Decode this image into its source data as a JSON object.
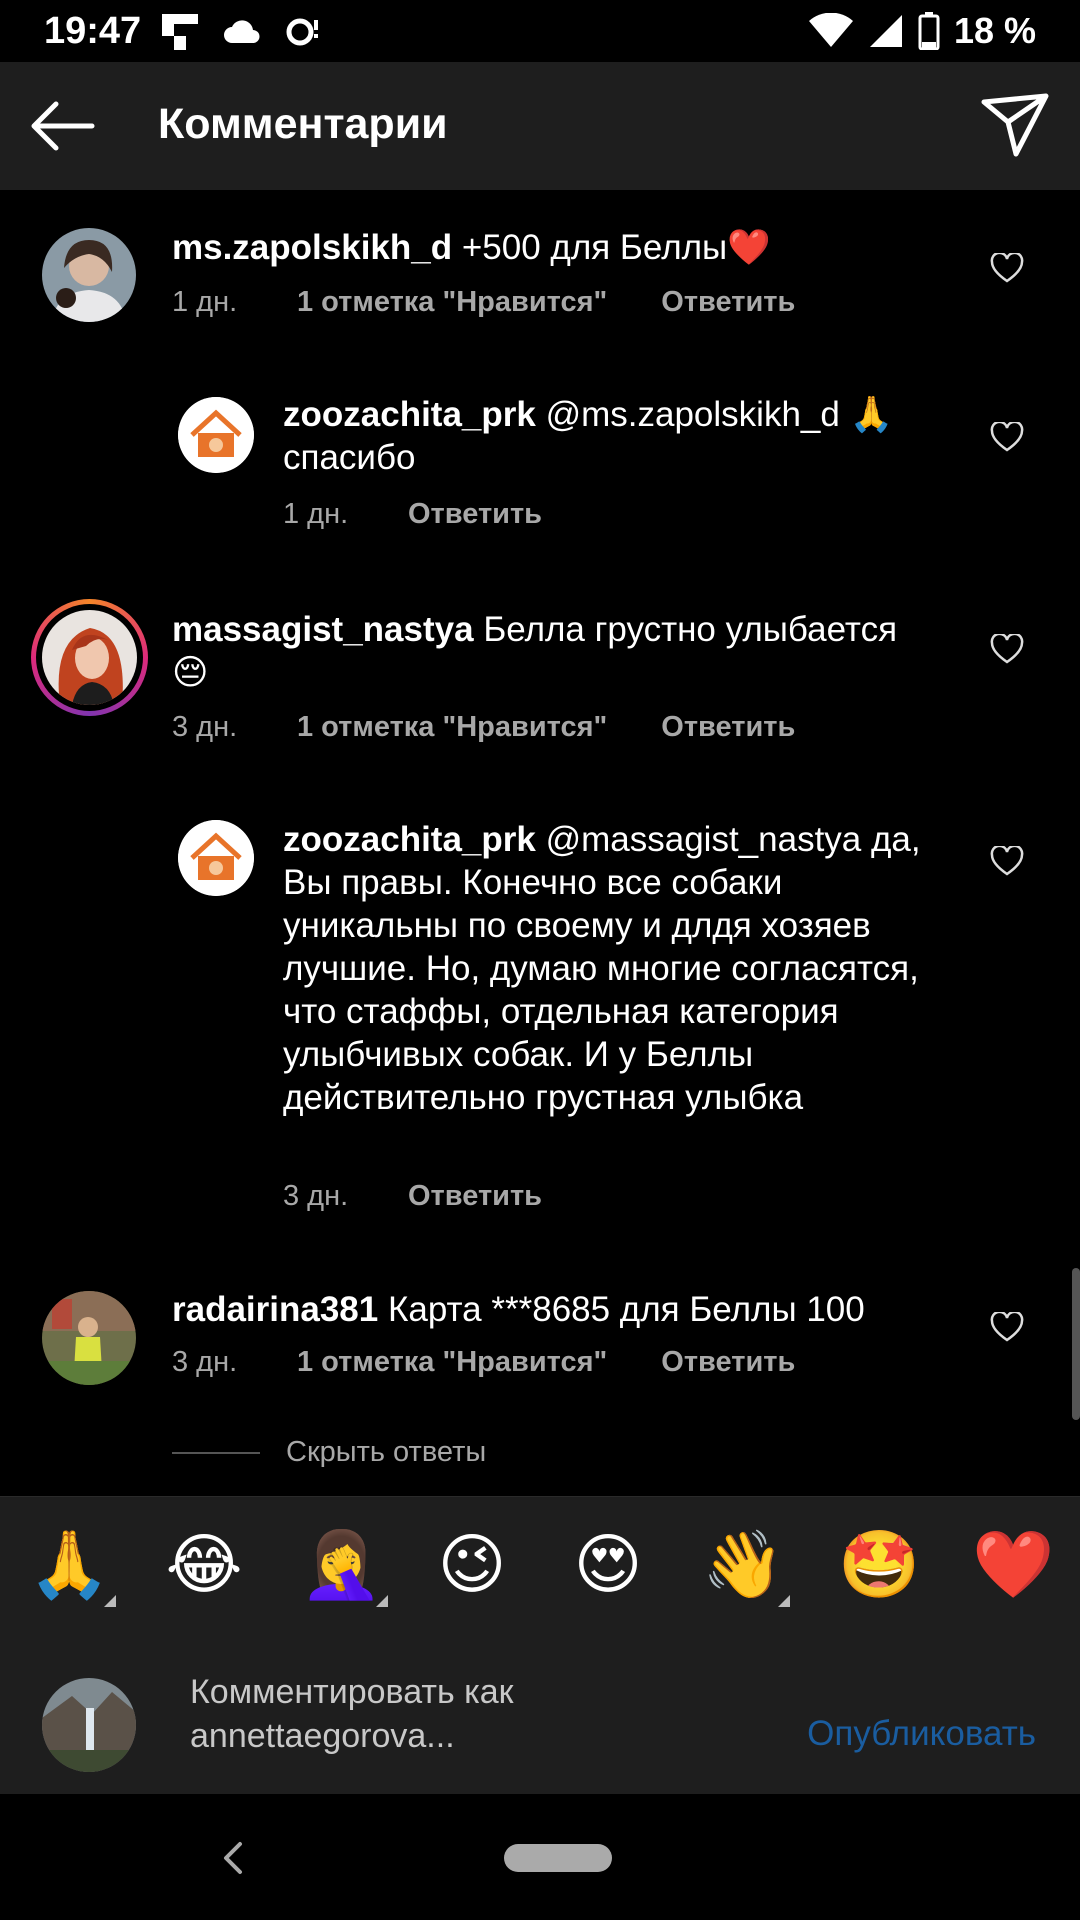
{
  "status_bar": {
    "time": "19:47",
    "battery": "18 %",
    "left_icons": [
      "flipboard-icon",
      "cloud-icon",
      "sync-icon"
    ],
    "right_icons": [
      "wifi-icon",
      "signal-icon",
      "battery-icon"
    ]
  },
  "header": {
    "title": "Комментарии",
    "back_icon": "arrow-left-icon",
    "share_icon": "send-icon"
  },
  "comments": [
    {
      "username": "ms.zapolskikh_d",
      "text": "+500 для Беллы❤️",
      "time": "1 дн.",
      "likes": "1 отметка \"Нравится\"",
      "reply": "Ответить"
    },
    {
      "username": "zoozachita_prk",
      "text": "@ms.zapolskikh_d 🙏 спасибо",
      "time": "1 дн.",
      "reply": "Ответить"
    },
    {
      "username": "massagist_nastya",
      "text": "Белла грустно улыбается 😔",
      "time": "3 дн.",
      "likes": "1 отметка \"Нравится\"",
      "reply": "Ответить"
    },
    {
      "username": "zoozachita_prk",
      "text": "@massagist_nastya да, Вы правы. Конечно все собаки уникальны по своему и длдя хозяев лучшие. Но, думаю многие согласятся, что стаффы, отдельная категория улыбчивых собак. И у Беллы действительно грустная улыбка",
      "time": "3 дн.",
      "reply": "Ответить"
    },
    {
      "username": "radairina381",
      "text": "Карта ***8685 для Беллы 100",
      "time": "3 дн.",
      "likes": "1 отметка \"Нравится\"",
      "reply": "Ответить"
    }
  ],
  "hide_replies": "Скрыть ответы",
  "emoji_bar": [
    "🙏",
    "😂",
    "🤦‍♀️",
    "😉",
    "😍",
    "👋",
    "🤩",
    "❤️"
  ],
  "compose": {
    "placeholder": "Комментировать как annettaegorova...",
    "publish": "Опубликовать"
  },
  "colors": {
    "background": "#000000",
    "bar_background": "#1e1e1e",
    "secondary_text": "#a8a8a8",
    "publish_disabled": "#1a5da0",
    "zoo_logo_orange": "#e8742a"
  }
}
